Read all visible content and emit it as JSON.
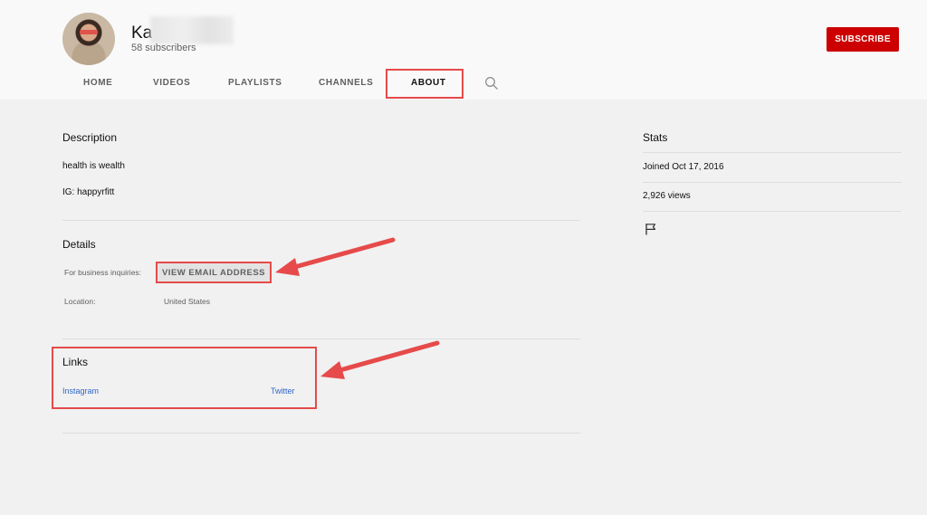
{
  "channel": {
    "name": "Ka",
    "subscribers": "58 subscribers",
    "subscribe_label": "SUBSCRIBE"
  },
  "tabs": [
    {
      "label": "HOME"
    },
    {
      "label": "VIDEOS"
    },
    {
      "label": "PLAYLISTS"
    },
    {
      "label": "CHANNELS"
    },
    {
      "label": "ABOUT",
      "active": true
    }
  ],
  "description": {
    "heading": "Description",
    "lines": [
      "health is wealth",
      "IG: happyrfitt"
    ]
  },
  "details": {
    "heading": "Details",
    "business_label": "For business inquiries:",
    "email_button": "VIEW EMAIL ADDRESS",
    "location_label": "Location:",
    "location_value": "United States"
  },
  "links": {
    "heading": "Links",
    "items": [
      "Instagram",
      "Twitter"
    ]
  },
  "stats": {
    "heading": "Stats",
    "joined": "Joined Oct 17, 2016",
    "views": "2,926 views"
  },
  "colors": {
    "subscribe_bg": "#cc0000",
    "annotation_red": "#e64a4a",
    "link_blue": "#3166c6",
    "page_bg": "#f1f1f1",
    "header_bg": "#f9f9f9"
  },
  "icons": [
    "search-icon",
    "flag-icon",
    "avatar"
  ]
}
